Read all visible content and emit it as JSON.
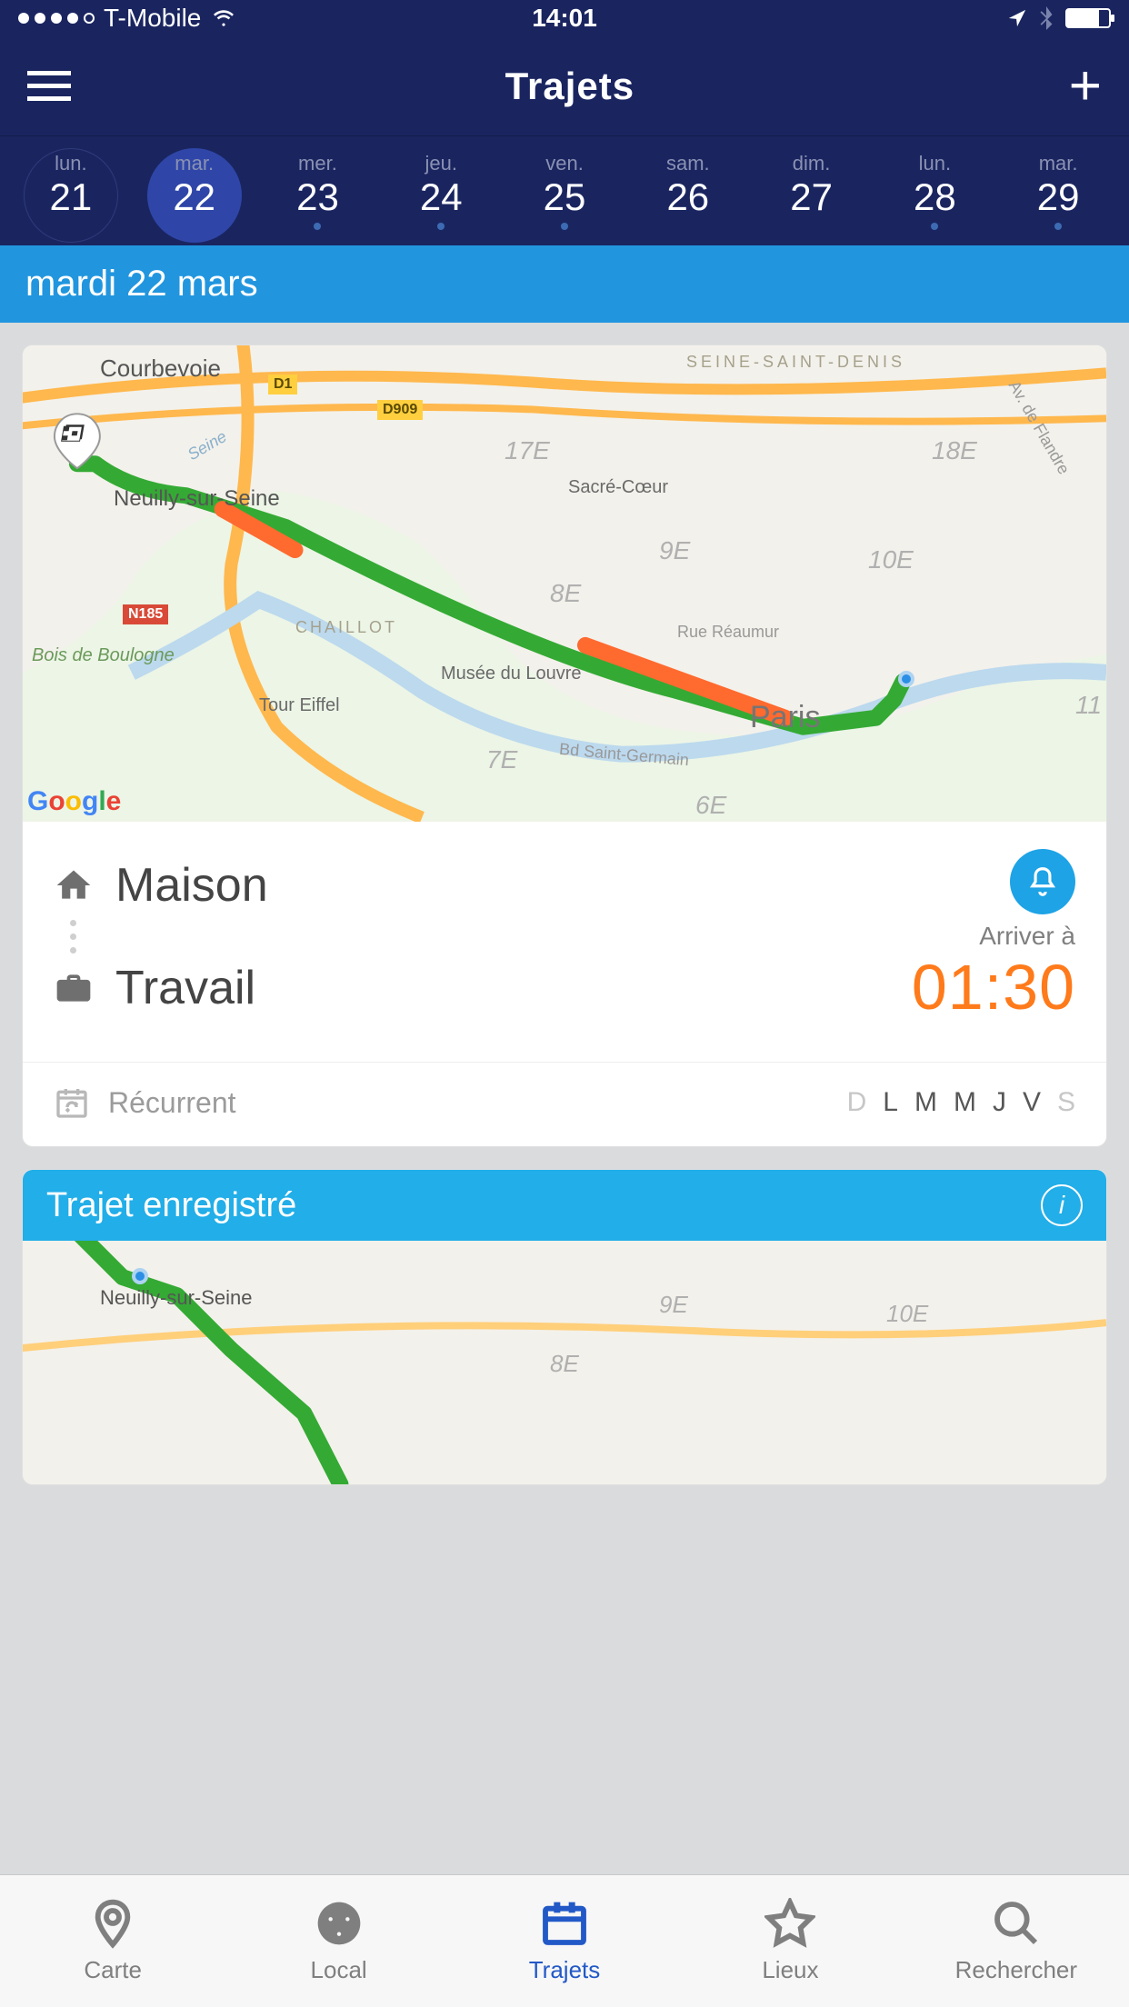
{
  "status": {
    "carrier": "T-Mobile",
    "time": "14:01"
  },
  "nav": {
    "title": "Trajets"
  },
  "dateStrip": [
    {
      "abbr": "lun.",
      "num": "21",
      "outline": true
    },
    {
      "abbr": "mar.",
      "num": "22",
      "selected": true
    },
    {
      "abbr": "mer.",
      "num": "23",
      "dot": true
    },
    {
      "abbr": "jeu.",
      "num": "24",
      "dot": true
    },
    {
      "abbr": "ven.",
      "num": "25",
      "dot": true
    },
    {
      "abbr": "sam.",
      "num": "26"
    },
    {
      "abbr": "dim.",
      "num": "27"
    },
    {
      "abbr": "lun.",
      "num": "28",
      "dot": true
    },
    {
      "abbr": "mar.",
      "num": "29",
      "dot": true
    }
  ],
  "dateHeader": "mardi 22 mars",
  "trip": {
    "from": "Maison",
    "to": "Travail",
    "arriveLabel": "Arriver à",
    "arriveTime": "01:30",
    "recurrentLabel": "Récurrent",
    "weekdays": [
      {
        "letter": "D",
        "on": false
      },
      {
        "letter": "L",
        "on": true
      },
      {
        "letter": "M",
        "on": true
      },
      {
        "letter": "M",
        "on": true
      },
      {
        "letter": "J",
        "on": true
      },
      {
        "letter": "V",
        "on": true
      },
      {
        "letter": "S",
        "on": false
      }
    ]
  },
  "mapLabels": {
    "courbevoie": "Courbevoie",
    "neuilly": "Neuilly-sur-Seine",
    "sacre": "Sacré-Cœur",
    "louvre": "Musée du Louvre",
    "eiffel": "Tour Eiffel",
    "paris": "Paris",
    "bois": "Bois de Boulogne",
    "chaillot": "CHAILLOT",
    "ssd": "SEINE-SAINT-DENIS",
    "reaumur": "Rue Réaumur",
    "stgermain": "Bd Saint-Germain",
    "flandre": "Av. de Flandre",
    "e7": "7E",
    "e8": "8E",
    "e9": "9E",
    "e10": "10E",
    "e17": "17E",
    "e18": "18E",
    "e6": "6E",
    "e11": "11",
    "d1": "D1",
    "d909": "D909",
    "n185": "N185",
    "seine": "Seine",
    "attrib": "Google"
  },
  "card2": {
    "title": "Trajet enregistré"
  },
  "tabs": [
    {
      "label": "Carte"
    },
    {
      "label": "Local"
    },
    {
      "label": "Trajets",
      "active": true
    },
    {
      "label": "Lieux"
    },
    {
      "label": "Rechercher"
    }
  ]
}
